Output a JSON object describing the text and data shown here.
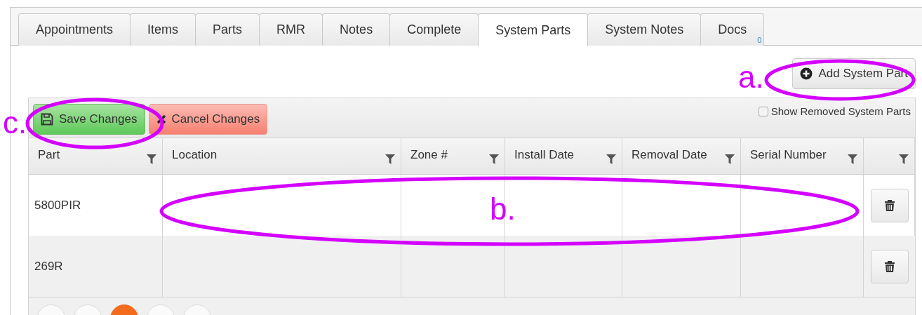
{
  "tabs": [
    {
      "label": "Appointments",
      "selected": false
    },
    {
      "label": "Items",
      "selected": false
    },
    {
      "label": "Parts",
      "selected": false
    },
    {
      "label": "RMR",
      "selected": false
    },
    {
      "label": "Notes",
      "selected": false
    },
    {
      "label": "Complete",
      "selected": false
    },
    {
      "label": "System Parts",
      "selected": true
    },
    {
      "label": "System Notes",
      "selected": false
    },
    {
      "label": "Docs",
      "selected": false,
      "badge": "0"
    }
  ],
  "add_button": {
    "label": "Add System Part"
  },
  "toolbar": {
    "save_button": "Save Changes",
    "cancel_button": "Cancel Changes",
    "show_removed": {
      "label": "Show Removed System Parts",
      "checked": false
    }
  },
  "table": {
    "columns": [
      "Part",
      "Location",
      "Zone #",
      "Install Date",
      "Removal Date",
      "Serial Number",
      ""
    ],
    "rows": [
      {
        "part": "5800PIR"
      },
      {
        "part": "269R"
      }
    ]
  },
  "pager": {
    "pages": [
      {
        "selected": false
      },
      {
        "selected": false
      },
      {
        "selected": true
      },
      {
        "selected": false
      },
      {
        "selected": false
      }
    ]
  },
  "annotations": [
    {
      "label": "a."
    },
    {
      "label": "b."
    },
    {
      "label": "c."
    }
  ]
}
